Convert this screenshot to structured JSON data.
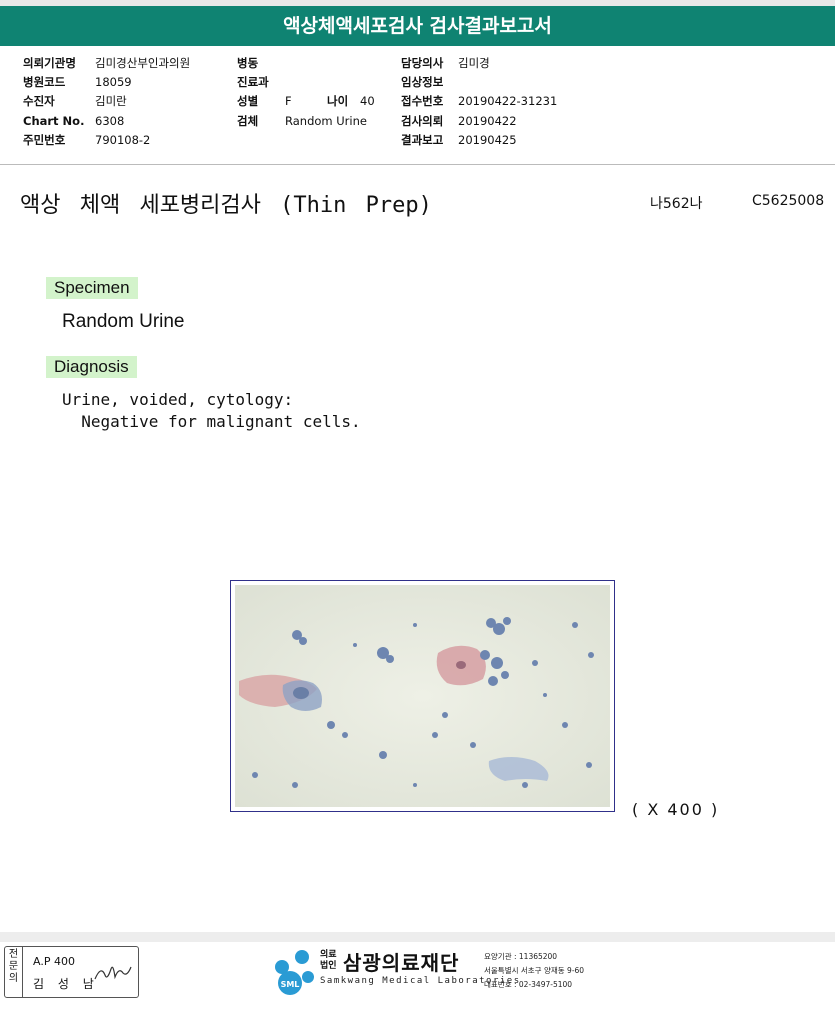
{
  "report": {
    "title": "액상체액세포검사 검사결과보고서"
  },
  "header": {
    "col1": [
      {
        "label": "의뢰기관명",
        "value": "김미경산부인과의원"
      },
      {
        "label": "병원코드",
        "value": "18059"
      },
      {
        "label": "수진자",
        "value": "김미란"
      },
      {
        "label": "Chart No.",
        "value": "6308"
      },
      {
        "label": "주민번호",
        "value": "790108-2"
      }
    ],
    "col2": [
      {
        "label": "병동",
        "value": ""
      },
      {
        "label": "진료과",
        "value": ""
      },
      {
        "label": "성별",
        "value": "F"
      },
      {
        "label": "검체",
        "value": "Random Urine"
      }
    ],
    "age": {
      "label": "나이",
      "value": "40"
    },
    "col3": [
      {
        "label": "담당의사",
        "value": "김미경"
      },
      {
        "label": "임상정보",
        "value": ""
      },
      {
        "label": "접수번호",
        "value": "20190422-31231"
      },
      {
        "label": "검사의뢰",
        "value": "20190422"
      },
      {
        "label": "결과보고",
        "value": "20190425"
      }
    ]
  },
  "test": {
    "title": "액상 체액 세포병리검사 (Thin Prep)",
    "code1": "나562나",
    "code2": "C5625008"
  },
  "specimen": {
    "label": "Specimen",
    "value": "Random Urine"
  },
  "diagnosis": {
    "label": "Diagnosis",
    "line1": "Urine, voided, cytology:",
    "line2": "  Negative for malignant cells."
  },
  "image": {
    "magnification": "( X 400 )"
  },
  "footer": {
    "stamp_label": "전문의",
    "stamp_license": "A.P 400",
    "stamp_name": "김 성 남",
    "logo_small1": "의료",
    "logo_small2": "법인",
    "logo_name": "삼광의료재단",
    "logo_en": "Samkwang Medical Laboratories",
    "logo_badge": "SML",
    "info1": "요양기관 : 11365200",
    "info2": "서울특별시 서초구 양재동 9-60",
    "info3": "대표번호 : 02-3497-5100"
  }
}
